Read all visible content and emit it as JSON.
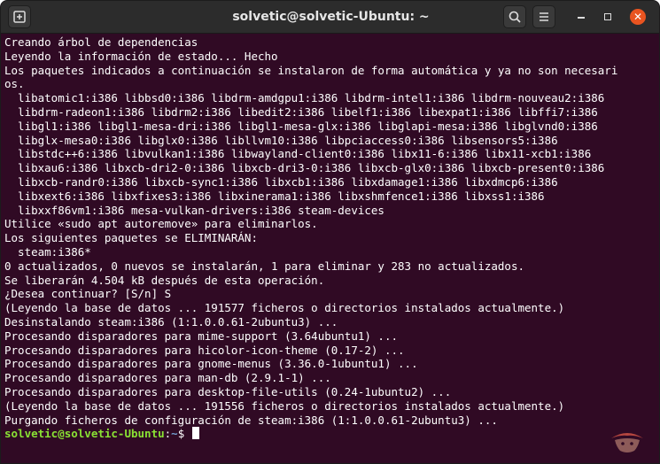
{
  "window": {
    "title": "solvetic@solvetic-Ubuntu: ~"
  },
  "titlebar": {
    "icons": [
      "new-tab-icon",
      "search-icon",
      "hamburger-menu-icon",
      "minimize-icon",
      "maximize-icon",
      "close-icon"
    ]
  },
  "colors": {
    "terminal_bg": "#300a24",
    "prompt_user": "#8ae234",
    "prompt_path": "#729fcf",
    "close_button": "#e95420"
  },
  "terminal": {
    "lines": [
      "Creando árbol de dependencias",
      "Leyendo la información de estado... Hecho",
      "Los paquetes indicados a continuación se instalaron de forma automática y ya no son necesari",
      "os.",
      "  libatomic1:i386 libbsd0:i386 libdrm-amdgpu1:i386 libdrm-intel1:i386 libdrm-nouveau2:i386",
      "  libdrm-radeon1:i386 libdrm2:i386 libedit2:i386 libelf1:i386 libexpat1:i386 libffi7:i386",
      "  libgl1:i386 libgl1-mesa-dri:i386 libgl1-mesa-glx:i386 libglapi-mesa:i386 libglvnd0:i386",
      "  libglx-mesa0:i386 libglx0:i386 libllvm10:i386 libpciaccess0:i386 libsensors5:i386",
      "  libstdc++6:i386 libvulkan1:i386 libwayland-client0:i386 libx11-6:i386 libx11-xcb1:i386",
      "  libxau6:i386 libxcb-dri2-0:i386 libxcb-dri3-0:i386 libxcb-glx0:i386 libxcb-present0:i386",
      "  libxcb-randr0:i386 libxcb-sync1:i386 libxcb1:i386 libxdamage1:i386 libxdmcp6:i386",
      "  libxext6:i386 libxfixes3:i386 libxinerama1:i386 libxshmfence1:i386 libxss1:i386",
      "  libxxf86vm1:i386 mesa-vulkan-drivers:i386 steam-devices",
      "Utilice «sudo apt autoremove» para eliminarlos.",
      "Los siguientes paquetes se ELIMINARÁN:",
      "  steam:i386*",
      "0 actualizados, 0 nuevos se instalarán, 1 para eliminar y 283 no actualizados.",
      "Se liberarán 4.504 kB después de esta operación.",
      "¿Desea continuar? [S/n] S",
      "(Leyendo la base de datos ... 191577 ficheros o directorios instalados actualmente.)",
      "Desinstalando steam:i386 (1:1.0.0.61-2ubuntu3) ...",
      "Procesando disparadores para mime-support (3.64ubuntu1) ...",
      "Procesando disparadores para hicolor-icon-theme (0.17-2) ...",
      "Procesando disparadores para gnome-menus (3.36.0-1ubuntu1) ...",
      "Procesando disparadores para man-db (2.9.1-1) ...",
      "Procesando disparadores para desktop-file-utils (0.24-1ubuntu2) ...",
      "(Leyendo la base de datos ... 191556 ficheros o directorios instalados actualmente.)",
      "Purgando ficheros de configuración de steam:i386 (1:1.0.0.61-2ubuntu3) ..."
    ],
    "prompt": {
      "user_host": "solvetic@solvetic-Ubuntu",
      "separator": ":",
      "path": "~",
      "symbol": "$ "
    }
  },
  "watermark": {
    "icon": "solvetic-logo-icon"
  }
}
